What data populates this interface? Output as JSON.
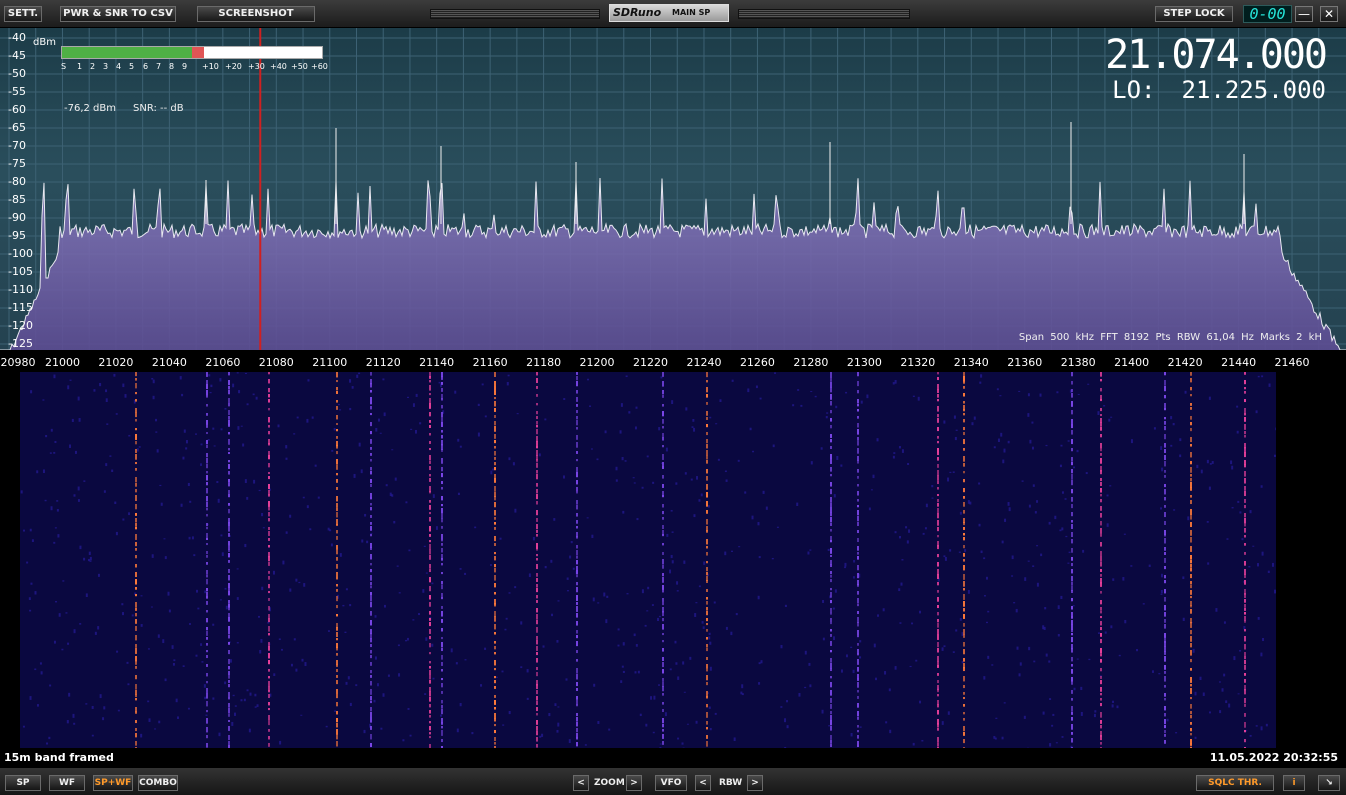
{
  "toolbar": {
    "settings_label": "SETT.",
    "pwr_snr_label": "PWR & SNR TO CSV",
    "screenshot_label": "SCREENSHOT",
    "app_logo": "SDRuno",
    "window_name": "MAIN SP",
    "step_lock_label": "STEP LOCK",
    "clock_display": "0-00",
    "minimize_label": "—",
    "close_label": "✕"
  },
  "spectrum": {
    "unit": "dBm",
    "y_ticks": [
      "-40",
      "-45",
      "-50",
      "-55",
      "-60",
      "-65",
      "-70",
      "-75",
      "-80",
      "-85",
      "-90",
      "-95",
      "-100",
      "-105",
      "-110",
      "-115",
      "-120",
      "-125"
    ],
    "smeter_scale": [
      "S",
      "1",
      "2",
      "3",
      "4",
      "5",
      "6",
      "7",
      "8",
      "9",
      "+10",
      "+20",
      "+30",
      "+40",
      "+50",
      "+60"
    ],
    "smeter_level_fraction": 0.5,
    "power_readout": "-76,2 dBm",
    "snr_readout": "SNR: -- dB",
    "vfo_frequency": "21.074.000",
    "lo_label": "LO:",
    "lo_frequency": "21.225.000",
    "info_line": "Span 500 kHz  FFT 8192 Pts  RBW 61,04 Hz  Marks 2 kH",
    "x_ticks": [
      "20980",
      "21000",
      "21020",
      "21040",
      "21060",
      "21080",
      "21100",
      "21120",
      "21140",
      "21160",
      "21180",
      "21200",
      "21220",
      "21240",
      "21260",
      "21280",
      "21300",
      "21320",
      "21340",
      "21360",
      "21380",
      "21400",
      "21420",
      "21440",
      "21460"
    ],
    "vfo_marker_khz": 21074,
    "colors": {
      "background": "#244250",
      "trace_fill": "#6a5aa0",
      "vfo_marker": "#d02020"
    }
  },
  "waterfall": {
    "status_left": "15m band framed",
    "status_right": "11.05.2022 20:32:55"
  },
  "bottombar": {
    "sp_label": "SP",
    "wf_label": "WF",
    "spwf_label": "SP+WF",
    "combo_label": "COMBO",
    "zoom_left": "<",
    "zoom_label": "ZOOM",
    "zoom_right": ">",
    "vfo_label": "VFO",
    "rbw_left": "<",
    "rbw_label": "RBW",
    "rbw_right": ">",
    "sqlc_label": "SQLC THR.",
    "info_label": "i",
    "resize_label": "↘"
  }
}
